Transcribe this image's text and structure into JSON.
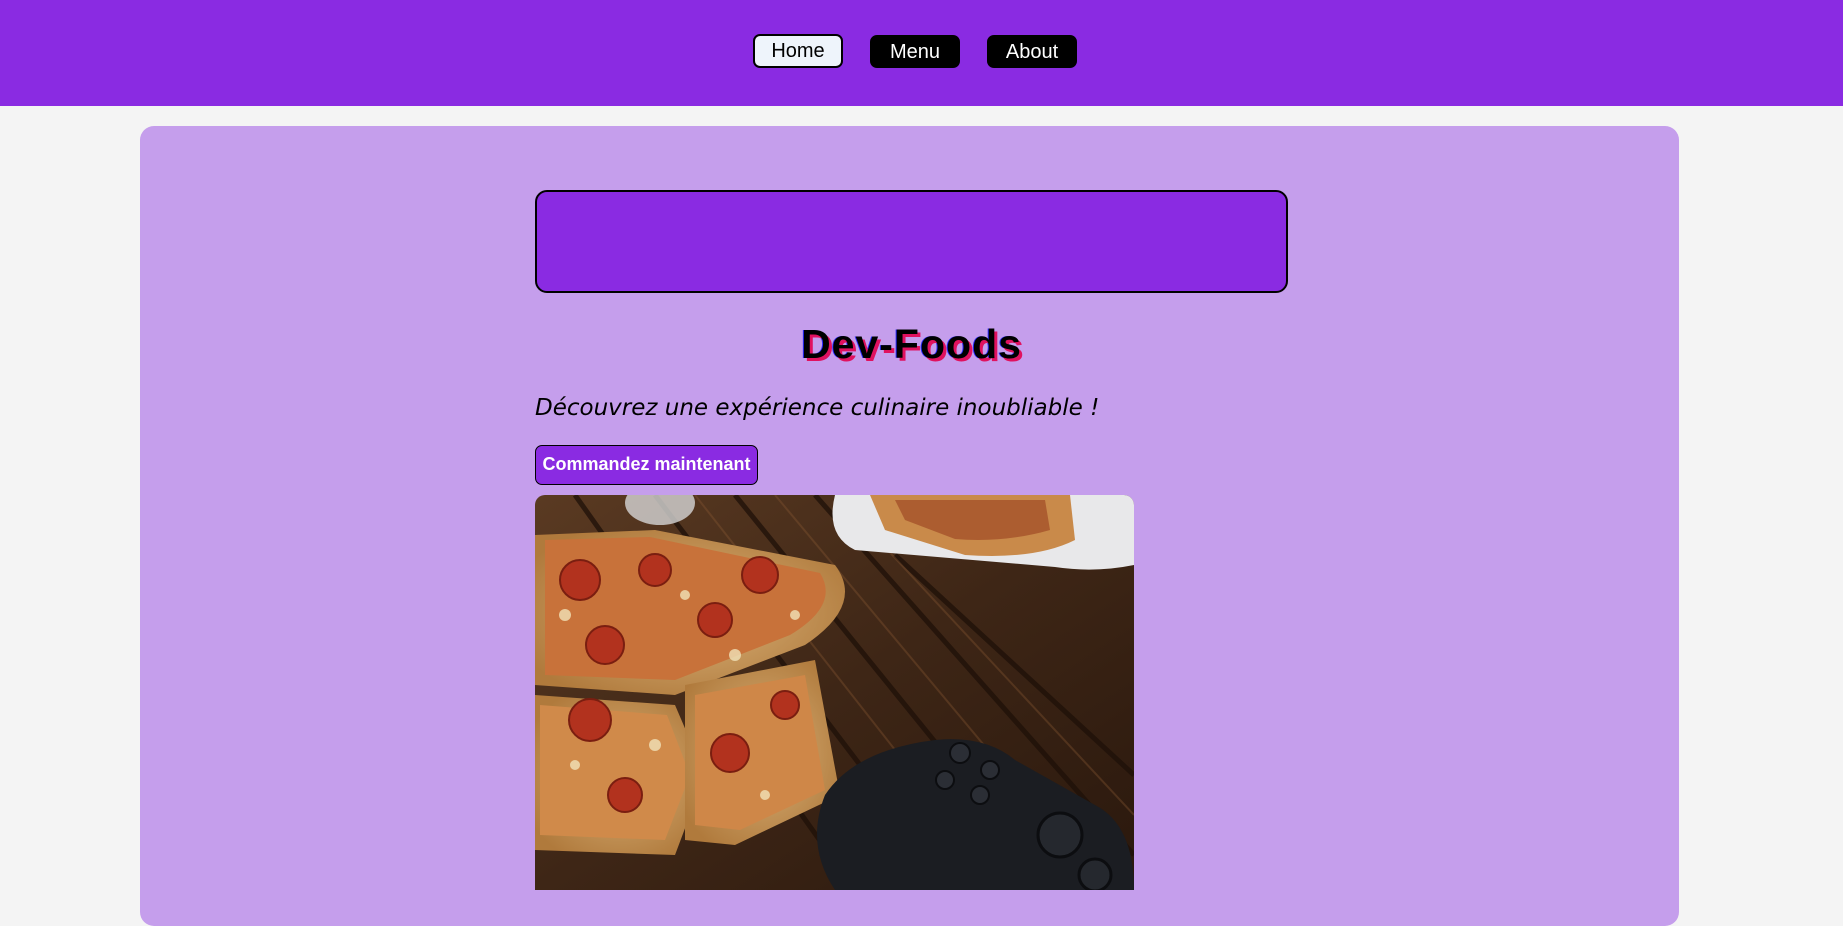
{
  "nav": {
    "items": [
      {
        "label": "Home"
      },
      {
        "label": "Menu"
      },
      {
        "label": "About"
      }
    ]
  },
  "hero": {
    "title": "Dev-Foods",
    "tagline": "Découvrez une expérience culinaire inoubliable !",
    "cta_label": "Commandez maintenant"
  },
  "colors": {
    "brand": "#8a2be2",
    "card_bg": "#c59eec",
    "page_bg": "#f4f4f4"
  }
}
